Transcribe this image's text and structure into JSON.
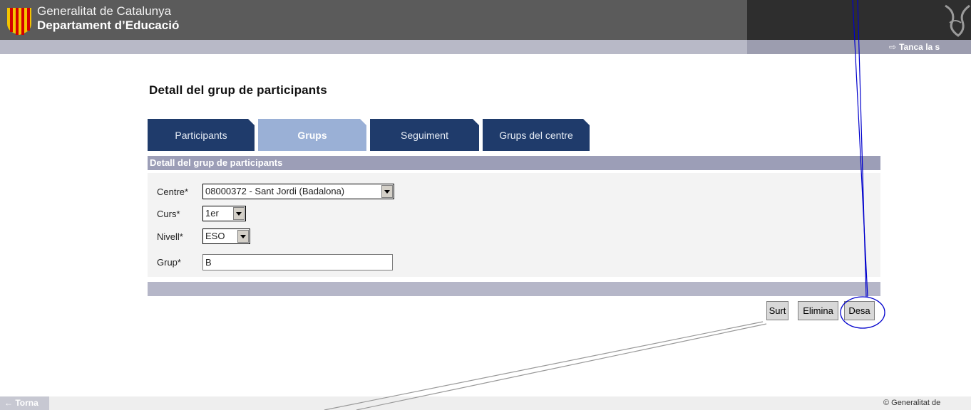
{
  "header": {
    "brand_line1": "Generalitat de Catalunya",
    "brand_line2": "Departament d’Educació",
    "logout_label": "Tanca la s",
    "logout_icon": "exit-arrow-icon",
    "colors": {
      "header_bg": "#5b5b5b",
      "header_dark": "#2e2e2e",
      "subbar": "#b8b9c7"
    }
  },
  "page": {
    "title": "Detall del grup de participants"
  },
  "tabs": [
    {
      "label": "Participants",
      "active": false
    },
    {
      "label": "Grups",
      "active": true
    },
    {
      "label": "Seguiment",
      "active": false
    },
    {
      "label": "Grups del centre",
      "active": false
    }
  ],
  "section": {
    "title": "Detall del grup de participants"
  },
  "form": {
    "centre": {
      "label": "Centre*",
      "value": "08000372 - Sant Jordi (Badalona)"
    },
    "curs": {
      "label": "Curs*",
      "value": "1er"
    },
    "nivell": {
      "label": "Nivell*",
      "value": "ESO"
    },
    "grup": {
      "label": "Grup*",
      "value": "B"
    }
  },
  "actions": {
    "surt": "Surt",
    "elimina": "Elimina",
    "desa": "Desa"
  },
  "footer": {
    "back_label": "← Torna",
    "copyright": "© Generalitat de"
  },
  "accent_colors": {
    "tab_dark": "#1f3b6b",
    "tab_active": "#9ab0d6",
    "annotation_line": "#0000cc"
  }
}
